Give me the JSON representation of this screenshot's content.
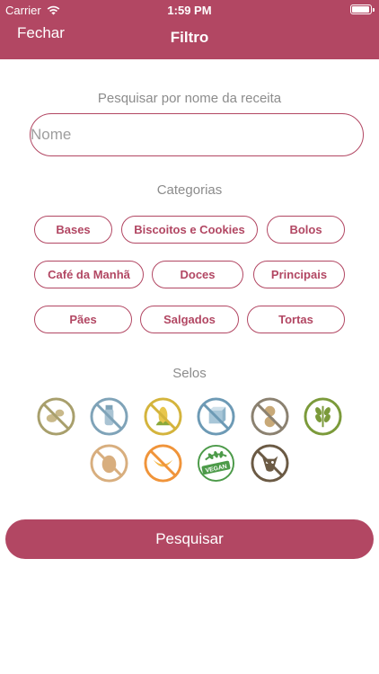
{
  "status_bar": {
    "carrier": "Carrier",
    "time": "1:59 PM"
  },
  "nav": {
    "close_label": "Fechar",
    "title": "Filtro"
  },
  "search": {
    "label": "Pesquisar por nome da receita",
    "placeholder": "Nome",
    "value": ""
  },
  "categories": {
    "label": "Categorias",
    "items": [
      "Bases",
      "Biscoitos e Cookies",
      "Bolos",
      "Café da Manhã",
      "Doces",
      "Principais",
      "Pães",
      "Salgados",
      "Tortas"
    ]
  },
  "seals": {
    "label": "Selos",
    "items": [
      {
        "icon": "no-soy-icon",
        "color": "#a89f6c"
      },
      {
        "icon": "no-lactose-icon",
        "color": "#7fa3b8"
      },
      {
        "icon": "no-corn-icon",
        "color": "#d4b43c"
      },
      {
        "icon": "no-sugar-icon",
        "color": "#6d9ab5"
      },
      {
        "icon": "no-peanut-icon",
        "color": "#8b8170"
      },
      {
        "icon": "gluten-free-icon",
        "color": "#7b9a3a"
      },
      {
        "icon": "no-egg-icon",
        "color": "#d8ae7e"
      },
      {
        "icon": "no-banana-icon",
        "color": "#f0943a"
      },
      {
        "icon": "vegan-icon",
        "color": "#4c9a49",
        "text": "VEGAN"
      },
      {
        "icon": "no-dairy-animal-icon",
        "color": "#6b5a44"
      }
    ]
  },
  "submit": {
    "label": "Pesquisar"
  },
  "colors": {
    "accent": "#b24763",
    "muted_text": "#8c8c8c"
  }
}
